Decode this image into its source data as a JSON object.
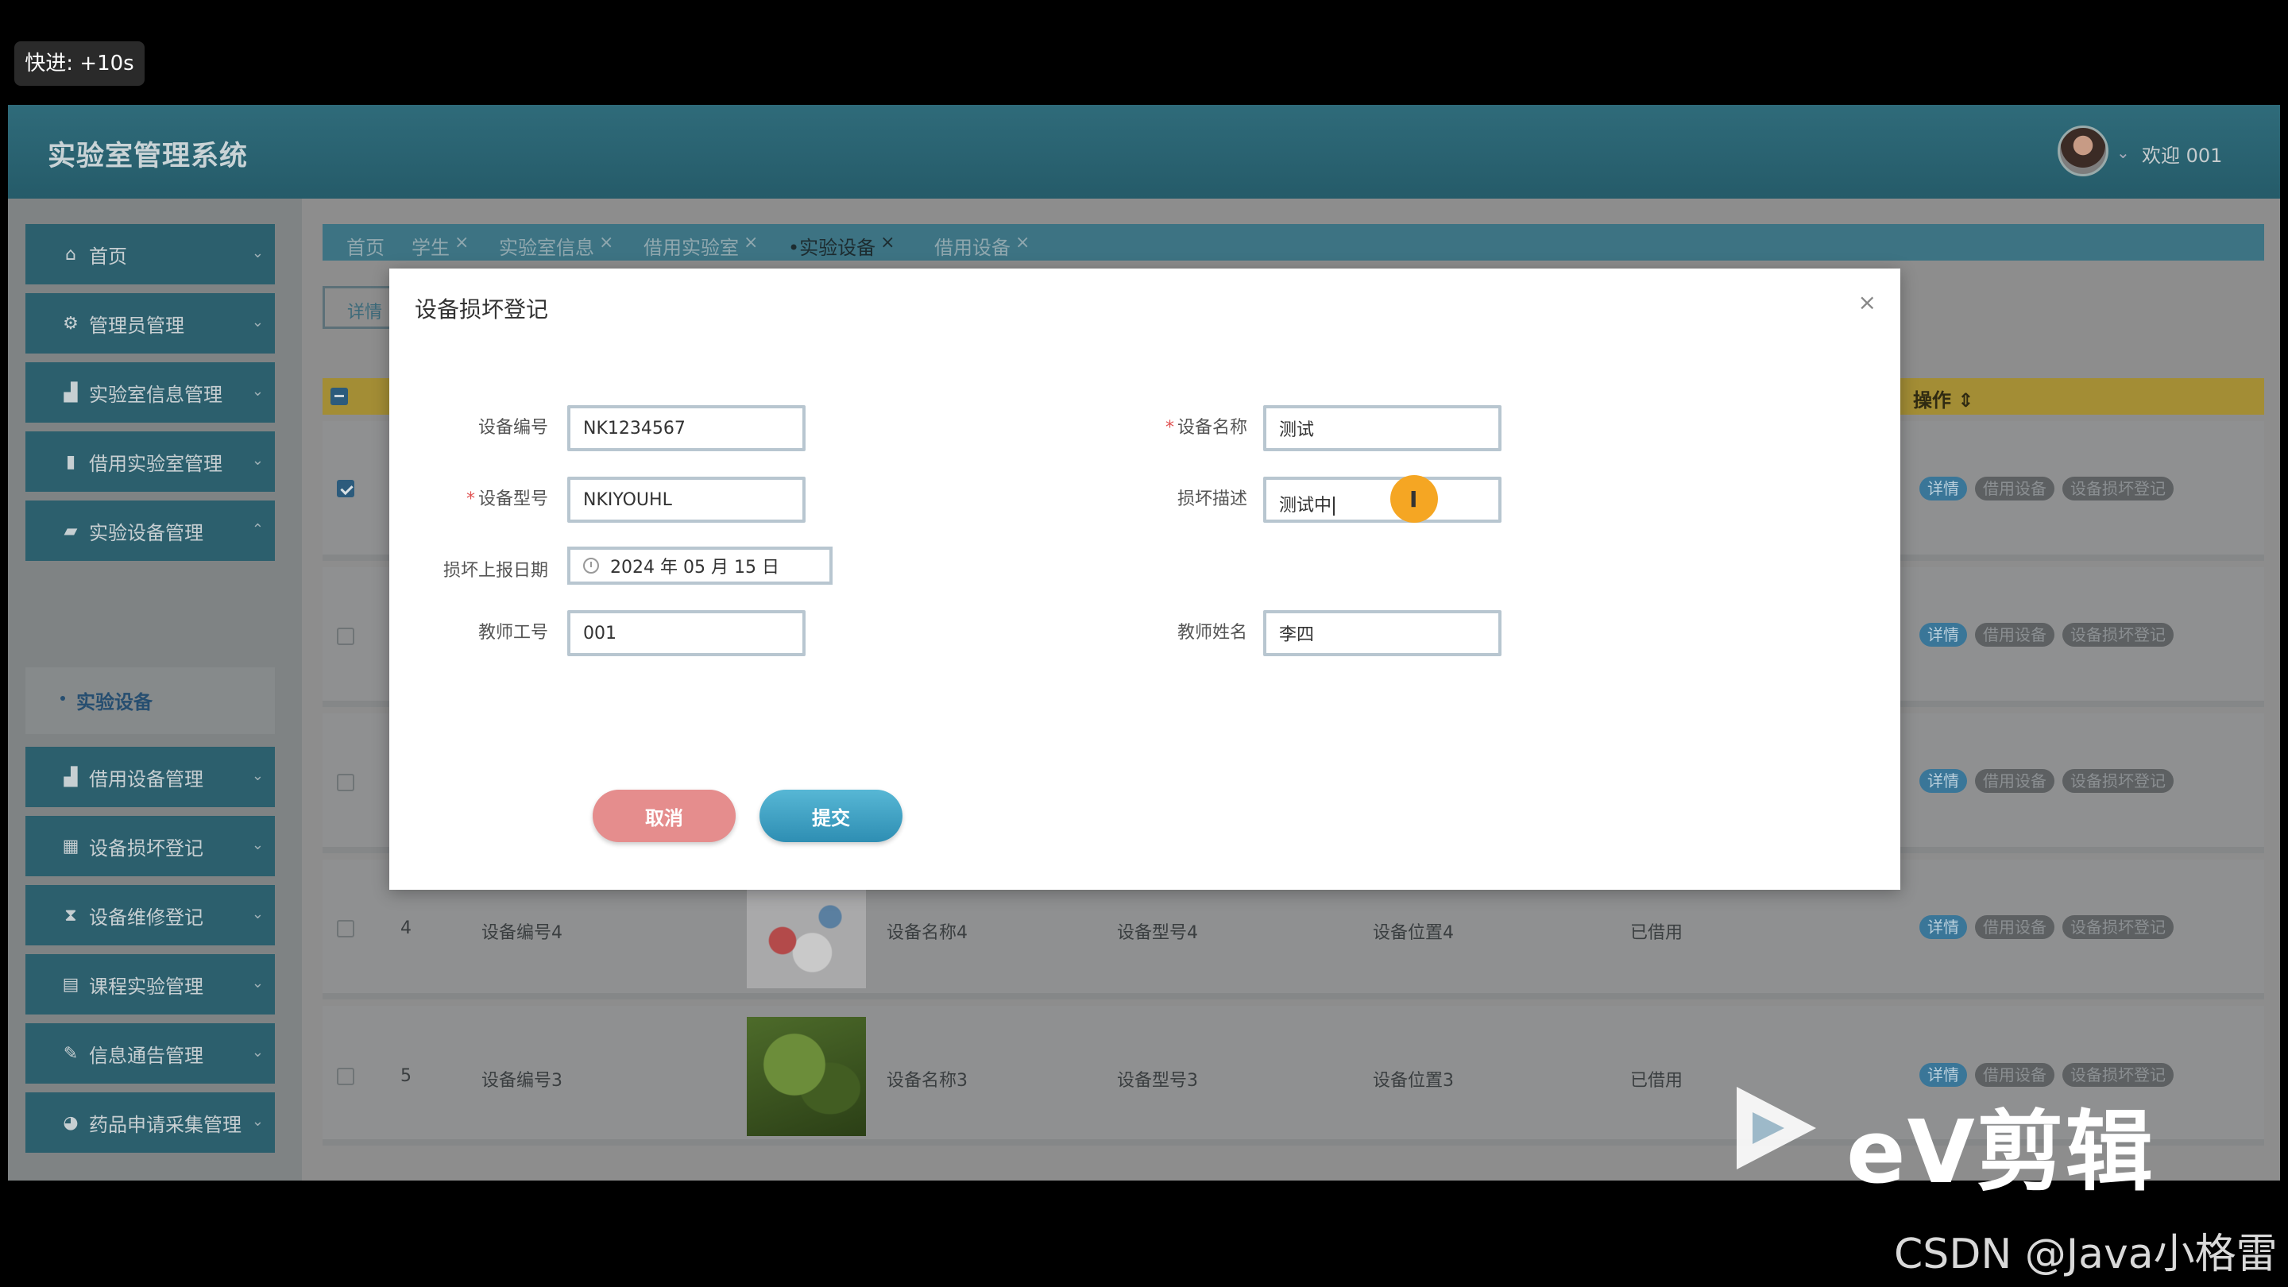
{
  "overlay": {
    "fast_forward": "快进: +10s"
  },
  "header": {
    "title": "实验室管理系统",
    "welcome": "欢迎 001"
  },
  "sidebar": {
    "items": [
      {
        "label": "首页",
        "icon": "home-icon"
      },
      {
        "label": "管理员管理",
        "icon": "gear-icon"
      },
      {
        "label": "实验室信息管理",
        "icon": "chart-icon"
      },
      {
        "label": "借用实验室管理",
        "icon": "book-icon"
      },
      {
        "label": "实验设备管理",
        "icon": "briefcase-icon"
      },
      {
        "label": "借用设备管理",
        "icon": "chart-icon"
      },
      {
        "label": "设备损坏登记",
        "icon": "grid-icon"
      },
      {
        "label": "设备维修登记",
        "icon": "hourglass-icon"
      },
      {
        "label": "课程实验管理",
        "icon": "table-icon"
      },
      {
        "label": "信息通告管理",
        "icon": "edit-icon"
      },
      {
        "label": "药品申请采集管理",
        "icon": "pie-icon"
      }
    ],
    "sub_item": "实验设备"
  },
  "tabs": [
    {
      "label": "首页",
      "closable": false,
      "active": false
    },
    {
      "label": "学生",
      "closable": true,
      "active": false
    },
    {
      "label": "实验室信息",
      "closable": true,
      "active": false
    },
    {
      "label": "借用实验室",
      "closable": true,
      "active": false
    },
    {
      "label": "实验设备",
      "closable": true,
      "active": true
    },
    {
      "label": "借用设备",
      "closable": true,
      "active": false
    }
  ],
  "content": {
    "detail_button": "详情",
    "op_header": "操作 ⇕",
    "op_buttons": {
      "detail": "详情",
      "borrow": "借用设备",
      "damage": "设备损坏登记"
    },
    "rows": [
      {
        "no": "4",
        "code": "设备编号4",
        "name": "设备名称4",
        "model": "设备型号4",
        "location": "设备位置4",
        "status": "已借用"
      },
      {
        "no": "5",
        "code": "设备编号3",
        "name": "设备名称3",
        "model": "设备型号3",
        "location": "设备位置3",
        "status": "已借用"
      }
    ]
  },
  "dialog": {
    "title": "设备损坏登记",
    "close": "×",
    "fields": {
      "code_label": "设备编号",
      "code_value": "NK1234567",
      "name_label": "设备名称",
      "name_value": "测试",
      "model_label": "设备型号",
      "model_value": "NKIYOUHL",
      "desc_label": "损坏描述",
      "desc_value": "测试中",
      "date_label": "损坏上报日期",
      "date_value": "2024 年 05 月 15 日",
      "teacher_id_label": "教师工号",
      "teacher_id_value": "001",
      "teacher_name_label": "教师姓名",
      "teacher_name_value": "李四"
    },
    "required_mark": "*",
    "cancel": "取消",
    "submit": "提交"
  },
  "watermark": {
    "ev": "eV剪辑",
    "csdn": "CSDN @Java小格雷"
  }
}
